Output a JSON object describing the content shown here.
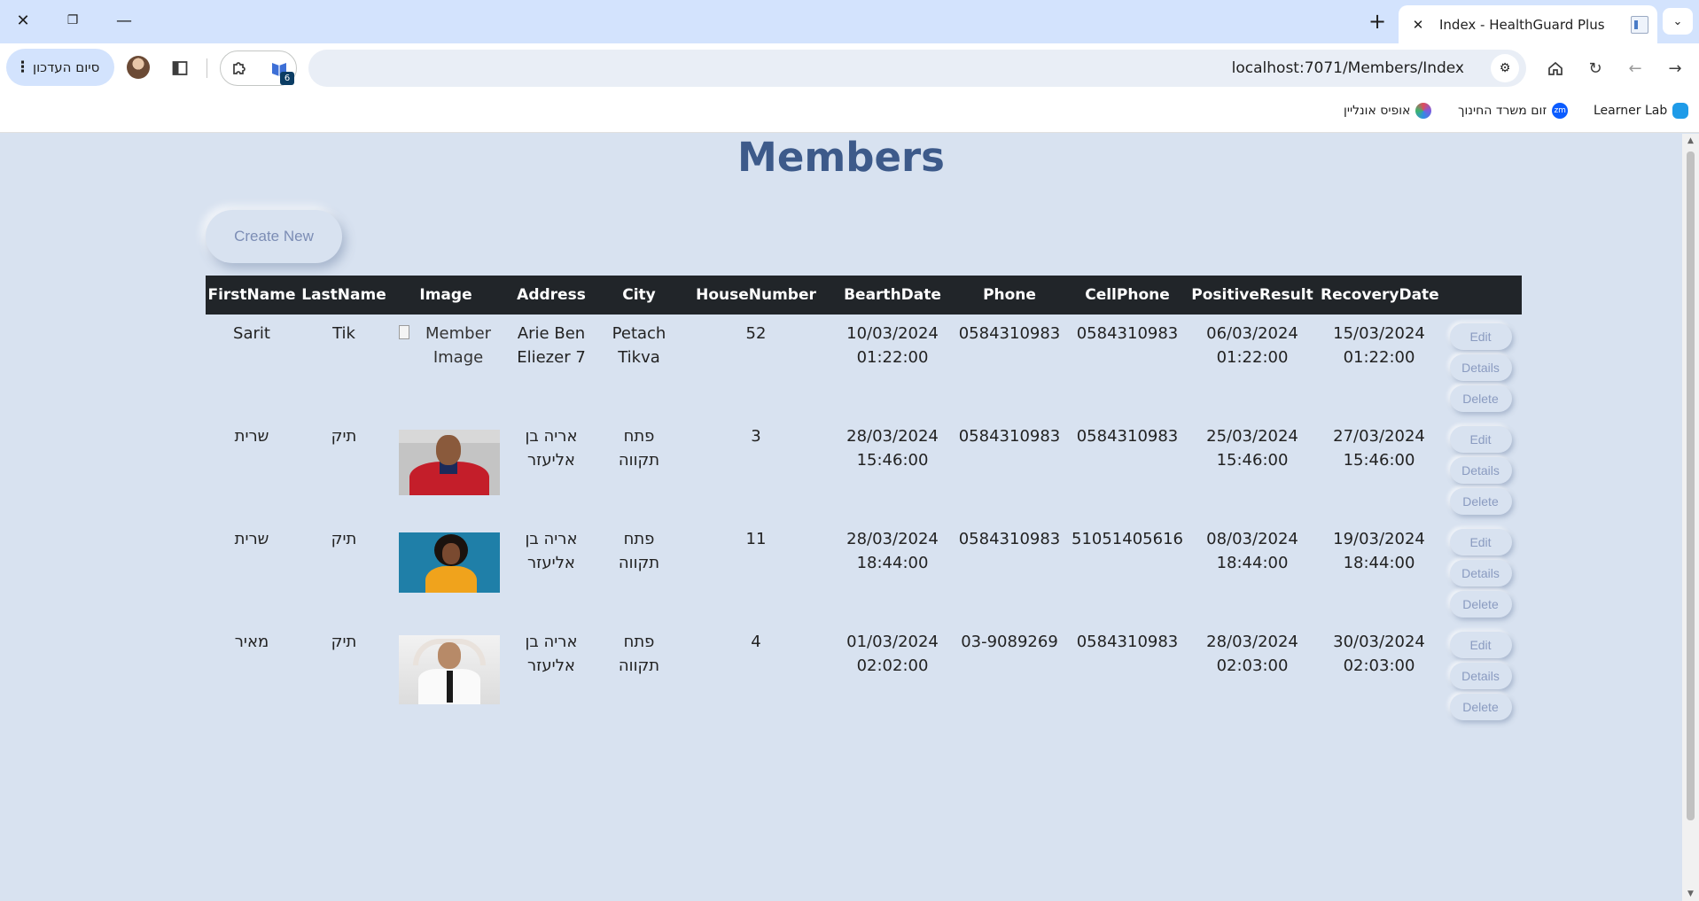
{
  "browser": {
    "tab_title": "Index - HealthGuard Plus",
    "url": "localhost:7071/Members/Index",
    "profile_label": "סיום העדכון",
    "extension_badge": "6",
    "bookmarks": [
      {
        "label": "Learner Lab",
        "icon": "cloud-icon",
        "color": "#1f9be8"
      },
      {
        "label": "זום משרד החינוך",
        "icon": "zoom-icon",
        "color": "#0b5cff",
        "badge": "zm"
      },
      {
        "label": "אופיס אונליין",
        "icon": "office-icon",
        "color": "#7b5ce0"
      }
    ]
  },
  "page": {
    "title": "Members",
    "create_new_label": "Create New",
    "columns": [
      "FirstName",
      "LastName",
      "Image",
      "Address",
      "City",
      "HouseNumber",
      "BearthDate",
      "Phone",
      "CellPhone",
      "PositiveResult",
      "RecoveryDate"
    ],
    "action_labels": {
      "edit": "Edit",
      "details": "Details",
      "delete": "Delete"
    },
    "rows": [
      {
        "first_name": "Sarit",
        "last_name": "Tik",
        "image_alt": "Member Image",
        "image_broken": true,
        "address": "Arie Ben Eliezer 7",
        "city": "Petach Tikva",
        "house_number": "52",
        "birth_date": "10/03/2024",
        "birth_time": "01:22:00",
        "phone": "0584310983",
        "cell_phone": "0584310983",
        "positive_date": "06/03/2024",
        "positive_time": "01:22:00",
        "recovery_date": "15/03/2024",
        "recovery_time": "01:22:00",
        "rtl": false
      },
      {
        "first_name": "שרית",
        "last_name": "תיק",
        "image_alt": "man in red shirt",
        "image_broken": false,
        "address": "אריה בן אליעזר",
        "city": "פתח תקווה",
        "house_number": "3",
        "birth_date": "28/03/2024",
        "birth_time": "15:46:00",
        "phone": "0584310983",
        "cell_phone": "0584310983",
        "positive_date": "25/03/2024",
        "positive_time": "15:46:00",
        "recovery_date": "27/03/2024",
        "recovery_time": "15:46:00",
        "rtl": true
      },
      {
        "first_name": "שרית",
        "last_name": "תיק",
        "image_alt": "woman in yellow sweater",
        "image_broken": false,
        "address": "אריה בן אליעזר",
        "city": "פתח תקווה",
        "house_number": "11",
        "birth_date": "28/03/2024",
        "birth_time": "18:44:00",
        "phone": "0584310983",
        "cell_phone": "51051405616",
        "positive_date": "08/03/2024",
        "positive_time": "18:44:00",
        "recovery_date": "19/03/2024",
        "recovery_time": "18:44:00",
        "rtl": true
      },
      {
        "first_name": "מאיר",
        "last_name": "תיק",
        "image_alt": "man relaxing with tie",
        "image_broken": false,
        "address": "אריה בן אליעזר",
        "city": "פתח תקווה",
        "house_number": "4",
        "birth_date": "01/03/2024",
        "birth_time": "02:02:00",
        "phone": "03-9089269",
        "cell_phone": "0584310983",
        "positive_date": "28/03/2024",
        "positive_time": "02:03:00",
        "recovery_date": "30/03/2024",
        "recovery_time": "02:03:00",
        "rtl": true
      }
    ]
  },
  "colors": {
    "page_bg": "#d8e2f0",
    "title": "#3d5a8a",
    "header_bg": "#212529",
    "button_text": "#8a9bc0",
    "tabstrip": "#d3e3fd"
  }
}
